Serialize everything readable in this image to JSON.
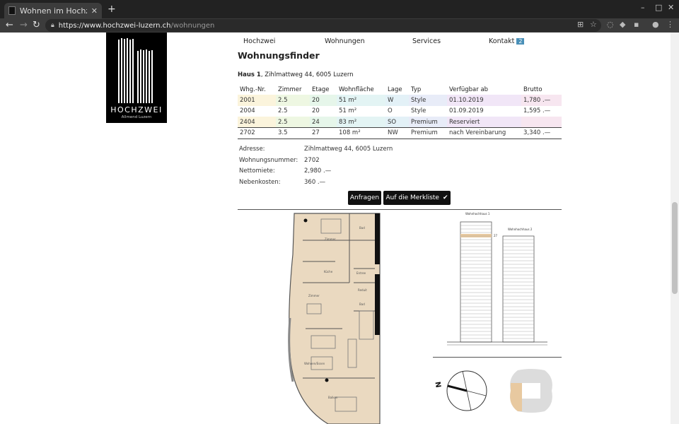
{
  "browser": {
    "tab_title": "Wohnen im Hochzwei Luz",
    "url_host": "https://www.hochzwei-luzern.ch",
    "url_path": "/wohnungen"
  },
  "logo": {
    "brand": "HOCHZWEI",
    "sub": "Allmend Luzern"
  },
  "nav": {
    "items": [
      "Hochzwei",
      "Wohnungen",
      "Services",
      "Kontakt"
    ],
    "kontakt_badge": "2"
  },
  "page": {
    "title": "Wohnungsfinder",
    "haus_label": "Haus 1",
    "haus_address": ", Zihlmattweg 44, 6005 Luzern"
  },
  "table": {
    "headers": [
      "Whg.-Nr.",
      "Zimmer",
      "Etage",
      "Wohnfläche",
      "Lage",
      "Typ",
      "Verfügbar ab",
      "Brutto"
    ],
    "rows": [
      [
        "2001",
        "2.5",
        "20",
        "51 m²",
        "W",
        "Style",
        "01.10.2019",
        "1,780 .—"
      ],
      [
        "2004",
        "2.5",
        "20",
        "51 m²",
        "O",
        "Style",
        "01.09.2019",
        "1,595 .—"
      ],
      [
        "2404",
        "2.5",
        "24",
        "83 m²",
        "SO",
        "Premium",
        "Reserviert",
        ""
      ],
      [
        "2702",
        "3.5",
        "27",
        "108 m²",
        "NW",
        "Premium",
        "nach Vereinbarung",
        "3,340 .—"
      ]
    ]
  },
  "details": {
    "labels": [
      "Adresse:",
      "Wohnungsnummer:",
      "Nettomiete:",
      "Nebenkosten:"
    ],
    "values": [
      "Zihlmattweg 44, 6005 Luzern",
      "2702",
      "2,980 .—",
      "360 .—"
    ]
  },
  "buttons": {
    "anfragen": "Anfragen",
    "merkliste": "Auf die Merkliste"
  },
  "plan": {
    "rooms": [
      "Zimmer",
      "Bad",
      "Küche",
      "Entree",
      "Zimmer",
      "Reduit",
      "Bad",
      "Wohnen/Essen",
      "Balkon"
    ],
    "tower1_label": "Wohnhochhaus 1",
    "tower2_label": "Wohnhochhaus 2",
    "floor_marker": "27",
    "compass_letter": "N"
  },
  "colors": {
    "row_style": "#fdf6e0",
    "row_style_b": "#e7f6ec",
    "row_cyan": "#e4f6f8",
    "row_pink": "#f6e4f3",
    "row_premium": "#f7e8f2",
    "highlight": "#e8c9a0"
  }
}
